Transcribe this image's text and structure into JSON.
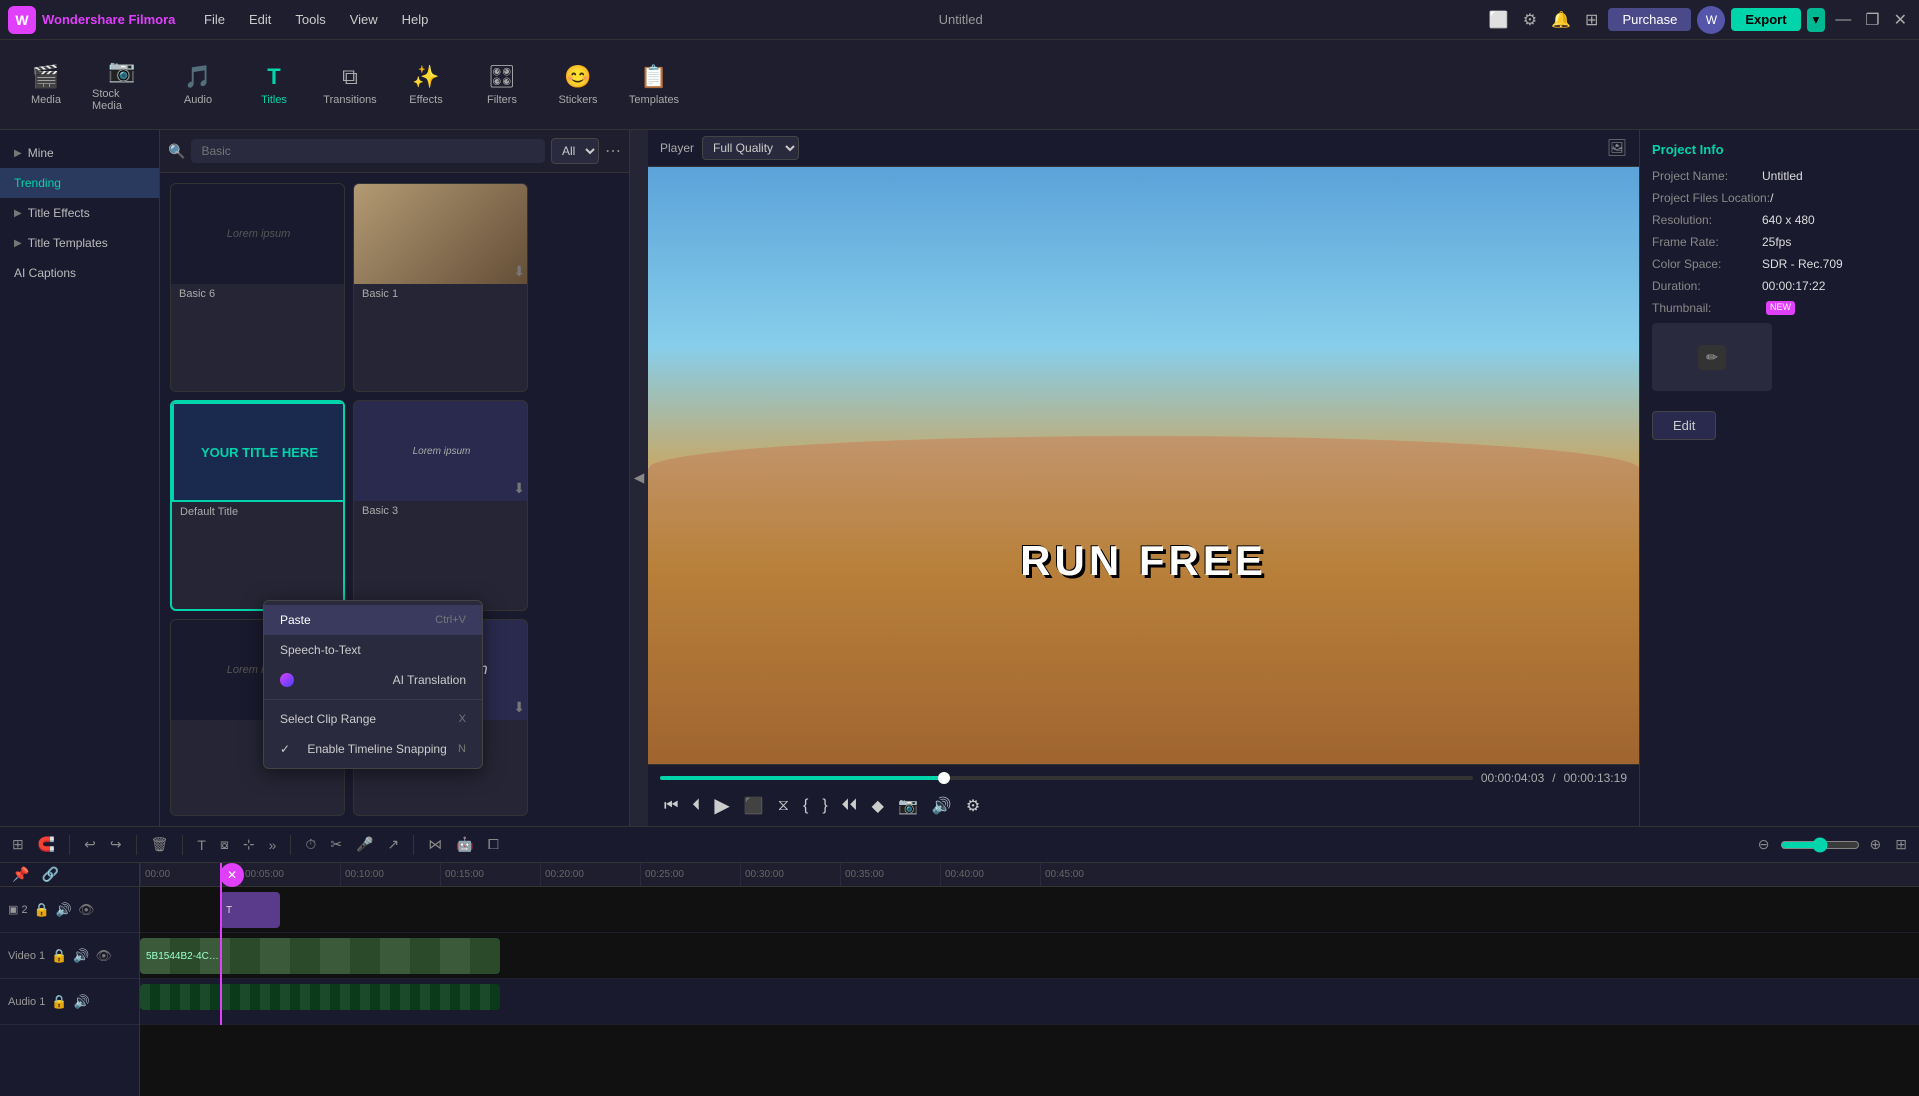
{
  "app": {
    "name": "Wondershare Filmora",
    "title": "Untitled",
    "logo_char": "W"
  },
  "menu": {
    "items": [
      "File",
      "Edit",
      "Tools",
      "View",
      "Help"
    ]
  },
  "topbar": {
    "purchase_label": "Purchase",
    "export_label": "Export",
    "win_title": "Untitled"
  },
  "toolbar": {
    "items": [
      {
        "id": "media",
        "label": "Media",
        "icon": "🎬"
      },
      {
        "id": "stock",
        "label": "Stock Media",
        "icon": "📷"
      },
      {
        "id": "audio",
        "label": "Audio",
        "icon": "🎵"
      },
      {
        "id": "titles",
        "label": "Titles",
        "icon": "T",
        "active": true
      },
      {
        "id": "transitions",
        "label": "Transitions",
        "icon": "⧉"
      },
      {
        "id": "effects",
        "label": "Effects",
        "icon": "✨"
      },
      {
        "id": "filters",
        "label": "Filters",
        "icon": "🎛"
      },
      {
        "id": "stickers",
        "label": "Stickers",
        "icon": "😊"
      },
      {
        "id": "templates",
        "label": "Templates",
        "icon": "📋"
      }
    ]
  },
  "sidebar": {
    "items": [
      {
        "id": "mine",
        "label": "Mine",
        "arrow": true
      },
      {
        "id": "trending",
        "label": "Trending",
        "active": true
      },
      {
        "id": "title-effects",
        "label": "Title Effects",
        "arrow": true
      },
      {
        "id": "title-templates",
        "label": "Title Templates",
        "arrow": true
      },
      {
        "id": "ai-captions",
        "label": "AI Captions"
      }
    ]
  },
  "search": {
    "placeholder": "Basic",
    "filter_options": [
      "All"
    ],
    "filter_selected": "All"
  },
  "assets": [
    {
      "id": "basic6",
      "label": "Basic 6",
      "thumb_type": "dark",
      "thumb_text": "Lorem ipsum",
      "has_dl": false
    },
    {
      "id": "basic1",
      "label": "Basic 1",
      "thumb_type": "photo",
      "thumb_text": "",
      "has_dl": true
    },
    {
      "id": "default",
      "label": "Default Title",
      "thumb_type": "default",
      "thumb_text": "YOUR TITLE HERE",
      "has_dl": false,
      "selected": true
    },
    {
      "id": "basic3",
      "label": "Basic 3",
      "thumb_type": "medium",
      "thumb_text": "Lorem ipsum",
      "has_dl": true
    },
    {
      "id": "basic_b1",
      "label": "",
      "thumb_type": "dark2",
      "thumb_text": "Lorem ipsum",
      "has_dl": false
    },
    {
      "id": "basic_b2",
      "label": "",
      "thumb_type": "light",
      "thumb_text": "Lorem ipsum",
      "has_dl": false
    }
  ],
  "player": {
    "label": "Player",
    "quality": "Full Quality",
    "preview_text": "RUN FREE",
    "current_time": "00:00:04:03",
    "total_time": "00:00:13:19",
    "progress_pct": 35
  },
  "project_info": {
    "tab": "Project Info",
    "name_label": "Project Name:",
    "name_value": "Untitled",
    "files_label": "Project Files Location:",
    "files_value": "/",
    "resolution_label": "Resolution:",
    "resolution_value": "640 x 480",
    "framerate_label": "Frame Rate:",
    "framerate_value": "25fps",
    "colorspace_label": "Color Space:",
    "colorspace_value": "SDR - Rec.709",
    "duration_label": "Duration:",
    "duration_value": "00:00:17:22",
    "thumbnail_label": "Thumbnail:",
    "thumbnail_badge": "NEW",
    "edit_label": "Edit"
  },
  "timeline": {
    "tracks": [
      {
        "id": "track2",
        "label": "▣ 2",
        "type": "title"
      },
      {
        "id": "video1",
        "label": "Video 1",
        "type": "video"
      },
      {
        "id": "audio1",
        "label": "Audio 1",
        "type": "audio"
      }
    ],
    "ruler_marks": [
      "00:00",
      "00:05:00",
      "00:10:00",
      "00:15:00",
      "00:20:00",
      "00:25:00",
      "00:30:00",
      "00:35:00",
      "00:40:00",
      "00:45:00"
    ],
    "playhead_position": "15%"
  },
  "context_menu": {
    "items": [
      {
        "id": "paste",
        "label": "Paste",
        "shortcut": "Ctrl+V",
        "highlighted": true
      },
      {
        "id": "speech-to-text",
        "label": "Speech-to-Text",
        "shortcut": ""
      },
      {
        "id": "ai-translation",
        "label": "AI Translation",
        "shortcut": "",
        "badge": true
      },
      {
        "id": "separator1"
      },
      {
        "id": "select-clip",
        "label": "Select Clip Range",
        "shortcut": "X"
      },
      {
        "id": "timeline-snap",
        "label": "Enable Timeline Snapping",
        "shortcut": "N",
        "checked": true
      }
    ]
  }
}
